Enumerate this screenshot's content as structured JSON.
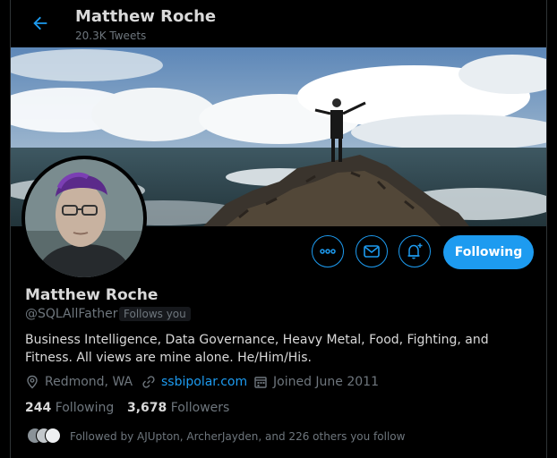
{
  "header": {
    "title": "Matthew Roche",
    "tweet_count": "20.3K Tweets"
  },
  "profile": {
    "name": "Matthew Roche",
    "handle": "@SQLAllFather",
    "follows_you": "Follows you",
    "bio": "Business Intelligence, Data Governance, Heavy Metal, Food, Fighting, and Fitness. All views are mine alone. He/Him/His.",
    "location": "Redmond, WA",
    "website": "ssbipolar.com",
    "joined": "Joined June 2011"
  },
  "actions": {
    "more_icon": "more-icon",
    "message_icon": "envelope-icon",
    "notify_icon": "bell-plus-icon",
    "follow_label": "Following"
  },
  "stats": {
    "following_count": "244",
    "following_label": "Following",
    "followers_count": "3,678",
    "followers_label": "Followers"
  },
  "followed_by": "Followed by AJUpton, ArcherJayden, and 226 others you follow",
  "colors": {
    "accent": "#1d9bf0",
    "background": "#000000",
    "text": "#d9d9d9",
    "muted": "#6e767d"
  }
}
